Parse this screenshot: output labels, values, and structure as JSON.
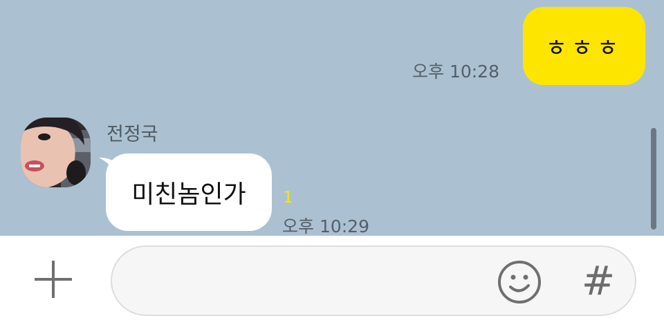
{
  "chat": {
    "outgoing_message": {
      "text": "ㅎㅎㅎ",
      "time": "오후 10:28"
    },
    "incoming_message": {
      "sender": "전정국",
      "text": "미친놈인가",
      "unread_count": "1",
      "time": "오후 10:29"
    }
  },
  "input_bar": {
    "text_value": "",
    "hash_symbol": "#",
    "icons": [
      "plus-icon",
      "emoji-icon",
      "hash-icon"
    ]
  },
  "colors": {
    "chat_background": "#abc1d1",
    "my_bubble": "#fee500",
    "other_bubble": "#ffffff",
    "unread_count": "#fee500"
  }
}
